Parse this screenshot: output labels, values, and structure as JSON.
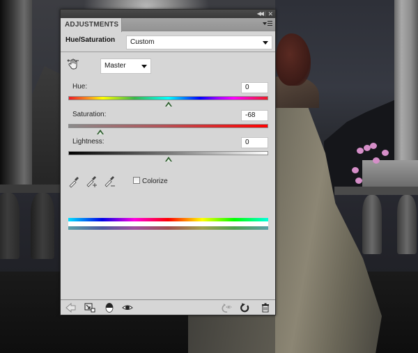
{
  "panel": {
    "title_tab": "ADJUSTMENTS",
    "titlebar_icons": [
      "collapse-icon",
      "close-icon"
    ],
    "menu_icon": "panel-menu-icon",
    "adjustment_name": "Hue/Saturation",
    "preset": {
      "selected": "Custom"
    },
    "channel": {
      "selected": "Master"
    },
    "targeted_tool_icon": "targeted-adjustment-hand-icon",
    "sliders": [
      {
        "id": "hue",
        "label": "Hue:",
        "value": "0",
        "min": -180,
        "max": 180,
        "position": 0
      },
      {
        "id": "saturation",
        "label": "Saturation:",
        "value": "-68",
        "min": -100,
        "max": 100,
        "position": -68
      },
      {
        "id": "lightness",
        "label": "Lightness:",
        "value": "0",
        "min": -100,
        "max": 100,
        "position": 0
      }
    ],
    "eyedroppers": [
      "eyedropper-icon",
      "eyedropper-add-icon",
      "eyedropper-subtract-icon"
    ],
    "colorize": {
      "label": "Colorize",
      "checked": false
    },
    "bottom_toolbar": {
      "left": [
        "back-arrow-icon",
        "clip-to-layer-icon",
        "view-previous-state-icon",
        "toggle-visibility-icon"
      ],
      "right": [
        "previous-state-icon",
        "reset-icon",
        "trash-icon"
      ]
    }
  }
}
